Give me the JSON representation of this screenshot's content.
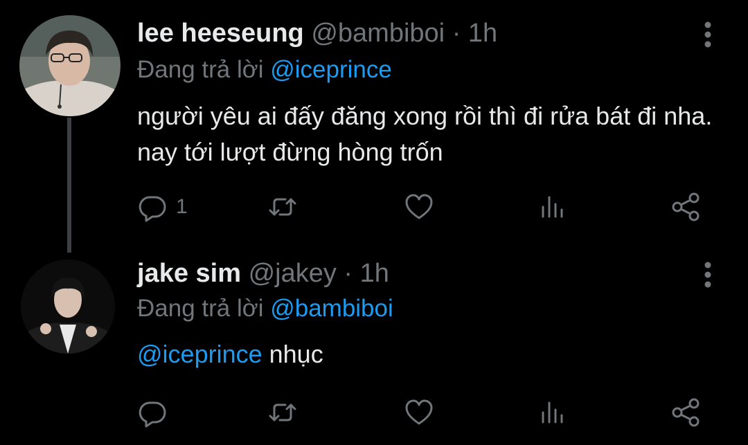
{
  "tweets": [
    {
      "author_name": "lee heeseung",
      "author_handle": "@bambiboi",
      "separator": "·",
      "time": "1h",
      "reply_prefix": "Đang trả lời",
      "reply_to": "@iceprince",
      "body_text": "người yêu ai đấy đăng xong rồi thì đi rửa bát đi nha. nay tới lượt đừng hòng trốn",
      "reply_count": "1",
      "avatar": "avatar-photo"
    },
    {
      "author_name": "jake sim",
      "author_handle": "@jakey",
      "separator": "·",
      "time": "1h",
      "reply_prefix": "Đang trả lời",
      "reply_to": "@bambiboi",
      "body_mention": "@iceprince",
      "body_text": " nhục",
      "reply_count": "",
      "avatar": "avatar-photo"
    }
  ],
  "icons": {
    "more": "more-vertical-icon",
    "reply": "comment-icon",
    "retweet": "retweet-icon",
    "like": "heart-icon",
    "stats": "bar-chart-icon",
    "share": "share-icon"
  },
  "colors": {
    "background": "#000000",
    "text": "#e7e9ea",
    "secondary": "#71767b",
    "link": "#1d9bf0",
    "thread_line": "#3b3e42"
  }
}
